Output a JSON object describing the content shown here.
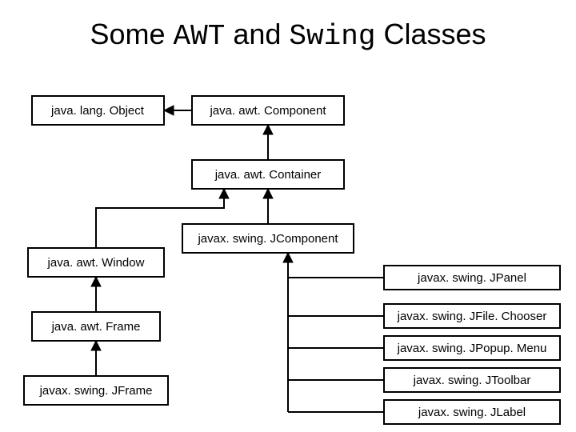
{
  "title": {
    "part1": "Some ",
    "part2": "AWT",
    "part3": " and ",
    "part4": "Swing",
    "part5": " Classes"
  },
  "boxes": {
    "object": "java. lang. Object",
    "component": "java. awt. Component",
    "container": "java. awt. Container",
    "jcomponent": "javax. swing. JComponent",
    "window": "java. awt. Window",
    "frame": "java. awt. Frame",
    "jframe": "javax. swing. JFrame",
    "jpanel": "javax. swing. JPanel",
    "jfilechooser": "javax. swing. JFile. Chooser",
    "jpopupmenu": "javax. swing. JPopup. Menu",
    "jtoolbar": "javax. swing. JToolbar",
    "jlabel": "javax. swing. JLabel"
  }
}
